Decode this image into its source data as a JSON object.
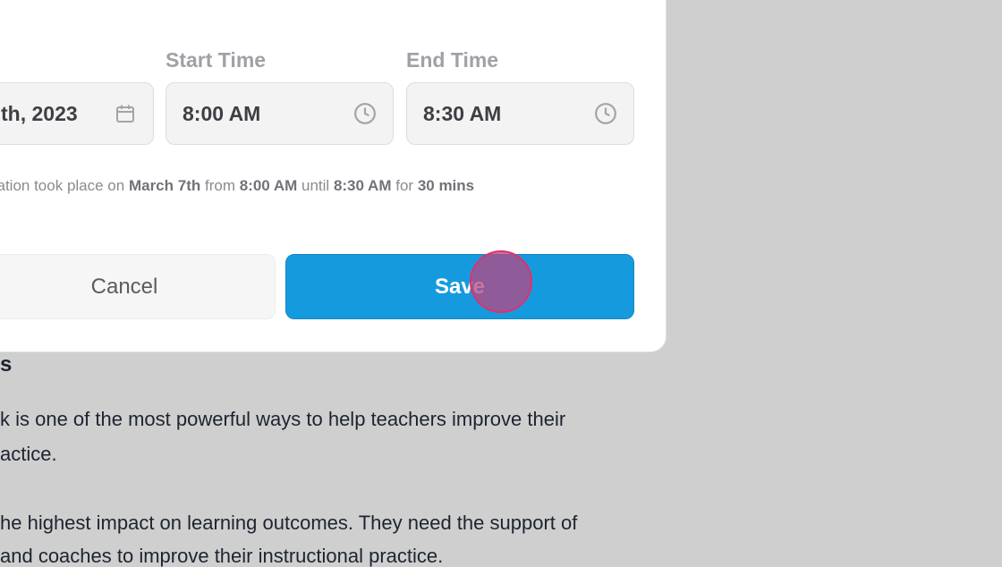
{
  "background_article": {
    "heading": "s",
    "line1": "k is one of the most powerful ways to help teachers improve their",
    "line2": "actice.",
    "line3": "he highest impact on learning outcomes. They need the support of",
    "line4": "and coaches to improve their instructional practice."
  },
  "modal": {
    "date_field": {
      "value": "th, 2023",
      "icon": "calendar-icon"
    },
    "start_time": {
      "label": "Start Time",
      "value": "8:00 AM",
      "icon": "clock-icon"
    },
    "end_time": {
      "label": "End Time",
      "value": "8:30 AM",
      "icon": "clock-icon"
    },
    "summary": {
      "prefix": "vation took place on",
      "date": "March 7th",
      "from_word": "from",
      "start": "8:00 AM",
      "until_word": "until",
      "end": "8:30 AM",
      "for_word": "for",
      "duration": "30 mins"
    },
    "buttons": {
      "cancel_label": "Cancel",
      "save_label": "Save"
    }
  },
  "colors": {
    "save_button": "#169ade",
    "cursor_highlight": "#e0306e",
    "backdrop": "#cfcfcf"
  }
}
